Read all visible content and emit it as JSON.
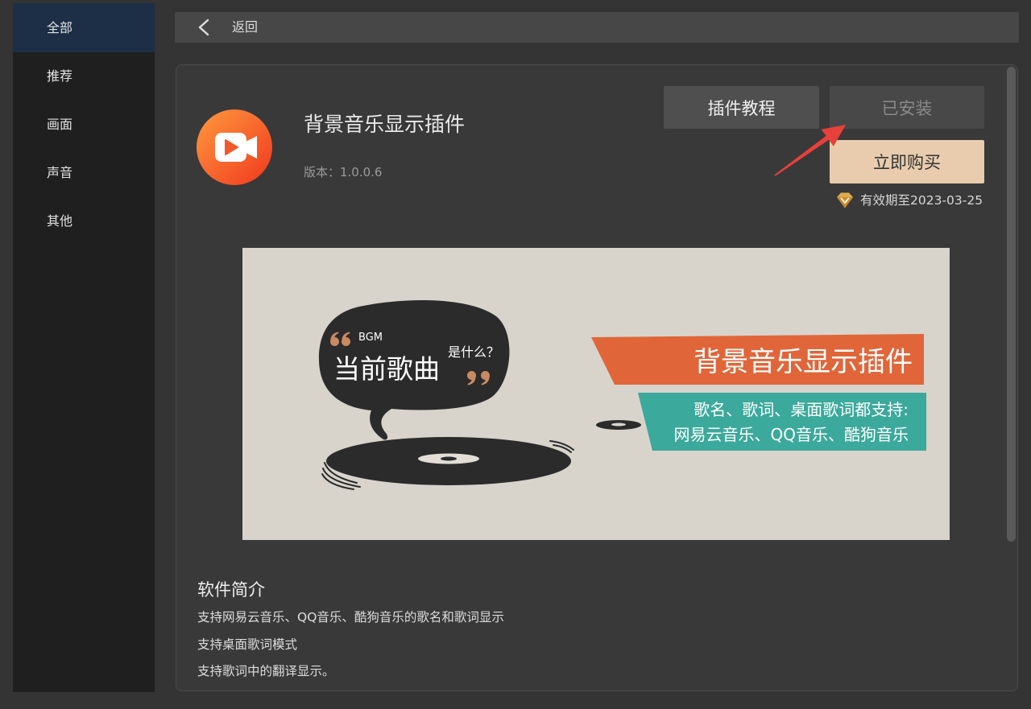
{
  "sidebar": {
    "items": [
      {
        "label": "全部",
        "selected": true
      },
      {
        "label": "推荐",
        "selected": false
      },
      {
        "label": "画面",
        "selected": false
      },
      {
        "label": "声音",
        "selected": false
      },
      {
        "label": "其他",
        "selected": false
      }
    ]
  },
  "topbar": {
    "back_icon": "chevron-left-icon",
    "back_label": "返回"
  },
  "plugin": {
    "icon": "video-camera-icon",
    "title": "背景音乐显示插件",
    "version": "版本：1.0.0.6"
  },
  "actions": {
    "tutorial_label": "插件教程",
    "installed_label": "已安装",
    "buy_label": "立即购买",
    "validity_icon": "diamond-icon",
    "validity": "有效期至2023-03-25"
  },
  "banner": {
    "bgm": "BGM",
    "current_song": "当前歌曲",
    "what_is": "是什么？",
    "title": "背景音乐显示插件",
    "line1": "歌名、歌词、桌面歌词都支持:",
    "line2": "网易云音乐、QQ音乐、酷狗音乐"
  },
  "intro": {
    "heading": "软件简介",
    "lines": [
      "支持网易云音乐、QQ音乐、酷狗音乐的歌名和歌词显示",
      "支持桌面歌词模式",
      "支持歌词中的翻译显示。"
    ]
  },
  "colors": {
    "sidebar_selected": "#1c2f46",
    "buy_button": "#e8ccad",
    "annotation_arrow": "#e8403a",
    "banner_orange": "#e06639",
    "banner_teal": "#3ba99b",
    "icon_gradient_start": "#ff9a3e",
    "icon_gradient_end": "#f0371d"
  }
}
